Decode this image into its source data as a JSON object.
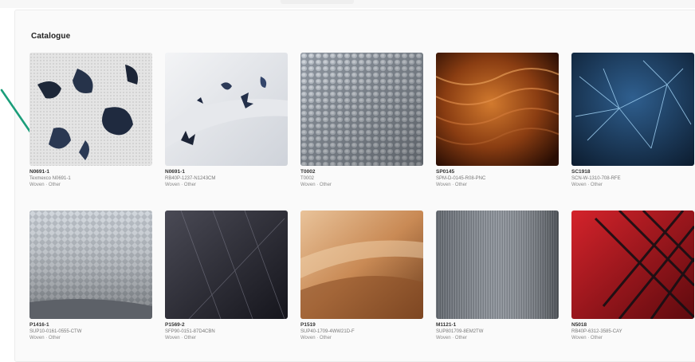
{
  "catalogue": {
    "title": "Catalogue",
    "items": [
      {
        "code": "N0691-1",
        "desc": "Texmexco N0691-1",
        "meta": "Woven · Other",
        "swatch": "white-blue-pattern"
      },
      {
        "code": "N0691-1",
        "desc": "RB40P-1237-N1243CM",
        "meta": "Woven · Other",
        "swatch": "white-navy-print"
      },
      {
        "code": "T0002",
        "desc": "T0002",
        "meta": "Woven · Other",
        "swatch": "grey-honeycomb"
      },
      {
        "code": "SP0145",
        "desc": "SPM-D-0145-R08-PNC",
        "meta": "Woven · Other",
        "swatch": "copper-silk"
      },
      {
        "code": "SC1918",
        "desc": "SCN-W-1310-708-RFE",
        "meta": "Woven · Other",
        "swatch": "blue-net"
      },
      {
        "code": "P1416-1",
        "desc": "SUP10-0161-0555-CTW",
        "meta": "Woven · Other",
        "swatch": "grey-diamond-weave"
      },
      {
        "code": "P1569-2",
        "desc": "SFP90-0151-87D4CBN",
        "meta": "Woven · Other",
        "swatch": "charcoal-stripe"
      },
      {
        "code": "P1519",
        "desc": "SUP40-1709-4WW21D-F",
        "meta": "Woven · Other",
        "swatch": "tan-suede"
      },
      {
        "code": "M1121-1",
        "desc": "SUP801709-8EM2TW",
        "meta": "Woven · Other",
        "swatch": "grey-tweed"
      },
      {
        "code": "N5018",
        "desc": "RB40P-6312-3585-CAY",
        "meta": "Woven · Other",
        "swatch": "red-black-lattice"
      }
    ]
  },
  "colors": {
    "accent_pointer": "#1b9e7a",
    "panel_bg": "#fafafa"
  }
}
